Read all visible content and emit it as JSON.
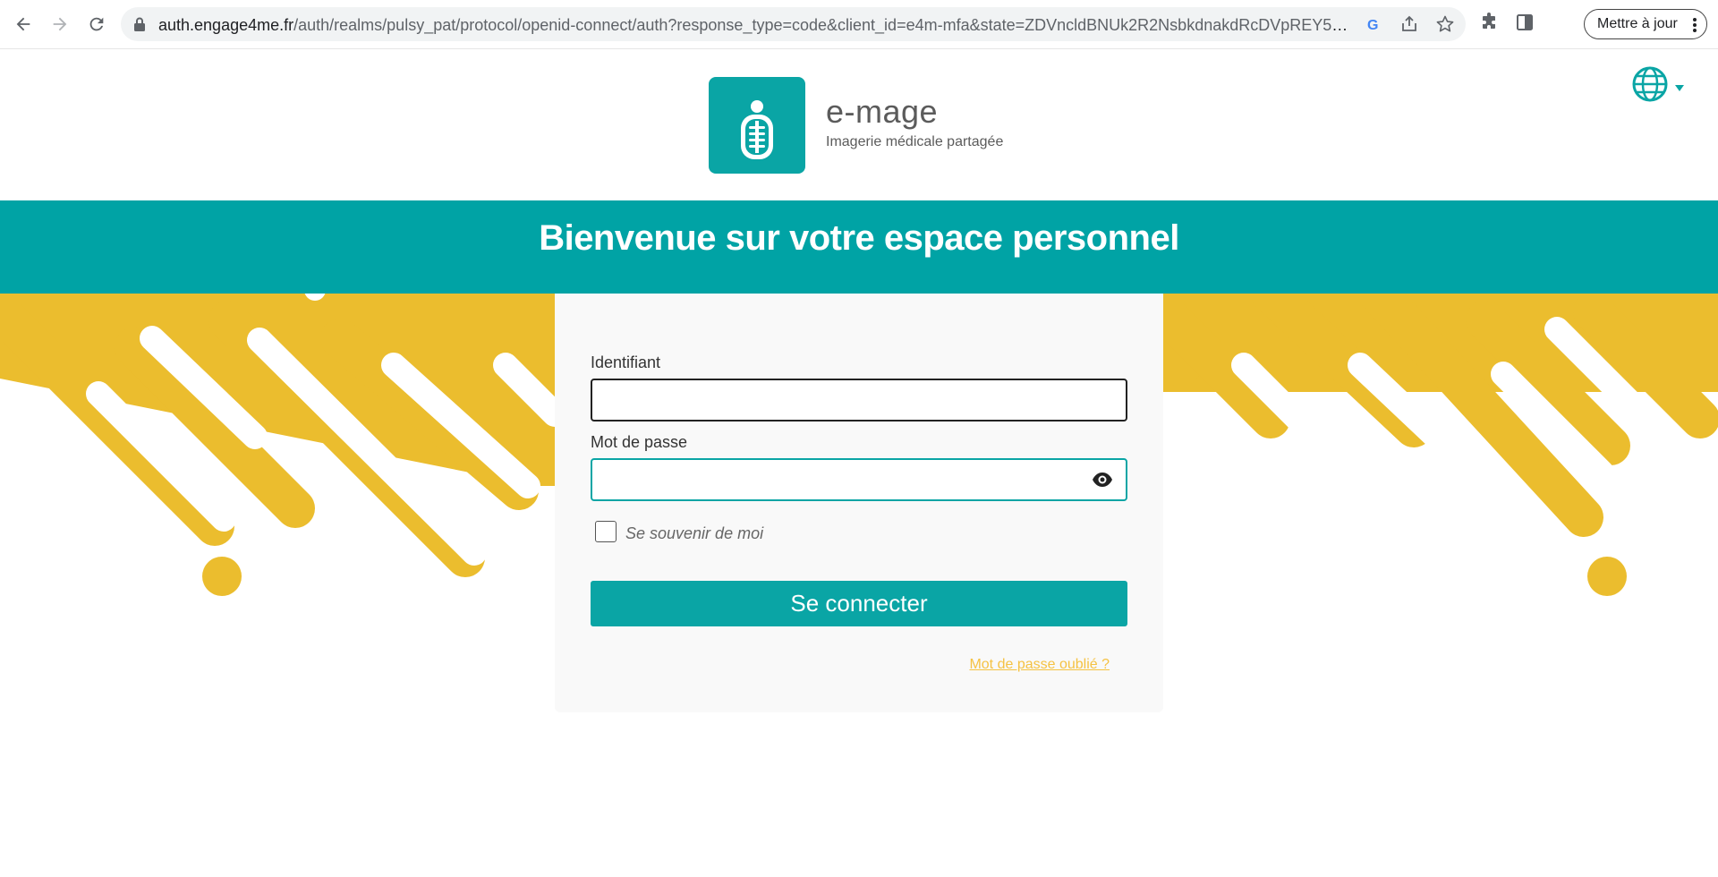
{
  "browser": {
    "url_host": "auth.engage4me.fr",
    "url_path": "/auth/realms/pulsy_pat/protocol/openid-connect/auth?response_type=code&client_id=e4m-mfa&state=ZDVncldBNUk2R2NsbkdnakdRcDVpREY5OWV...",
    "update_label": "Mettre à jour"
  },
  "brand": {
    "name": "e-mage",
    "tagline": "Imagerie médicale partagée",
    "color": "#0aa5a5"
  },
  "banner": {
    "title": "Bienvenue sur votre espace personnel"
  },
  "form": {
    "username_label": "Identifiant",
    "username_value": "",
    "password_label": "Mot de passe",
    "password_value": "",
    "remember_label": "Se souvenir de moi",
    "remember_checked": false,
    "submit_label": "Se connecter",
    "forgot_label": "Mot de passe oublié ?"
  },
  "colors": {
    "accent": "#0aa5a5",
    "decor": "#ebbd2e",
    "link": "#f5c242"
  }
}
